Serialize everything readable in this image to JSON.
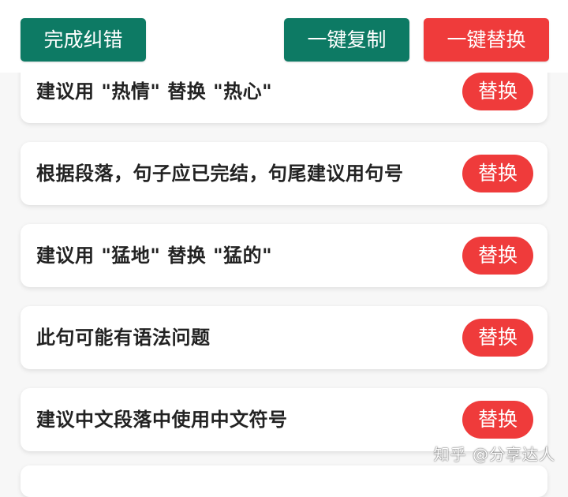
{
  "toolbar": {
    "finish_label": "完成纠错",
    "copy_all_label": "一键复制",
    "replace_all_label": "一键替换"
  },
  "suggestions": [
    {
      "text": "建议用 \"热情\" 替换 \"热心\"",
      "action": "替换"
    },
    {
      "text": "根据段落，句子应已完结，句尾建议用句号",
      "action": "替换"
    },
    {
      "text": "建议用 \"猛地\" 替换 \"猛的\"",
      "action": "替换"
    },
    {
      "text": "此句可能有语法问题",
      "action": "替换"
    },
    {
      "text": "建议中文段落中使用中文符号",
      "action": "替换"
    }
  ],
  "watermark": "知乎 @分享达人",
  "colors": {
    "green": "#0d7a64",
    "red": "#ef3b3b",
    "text": "#222222",
    "background": "#f7f7f7"
  }
}
